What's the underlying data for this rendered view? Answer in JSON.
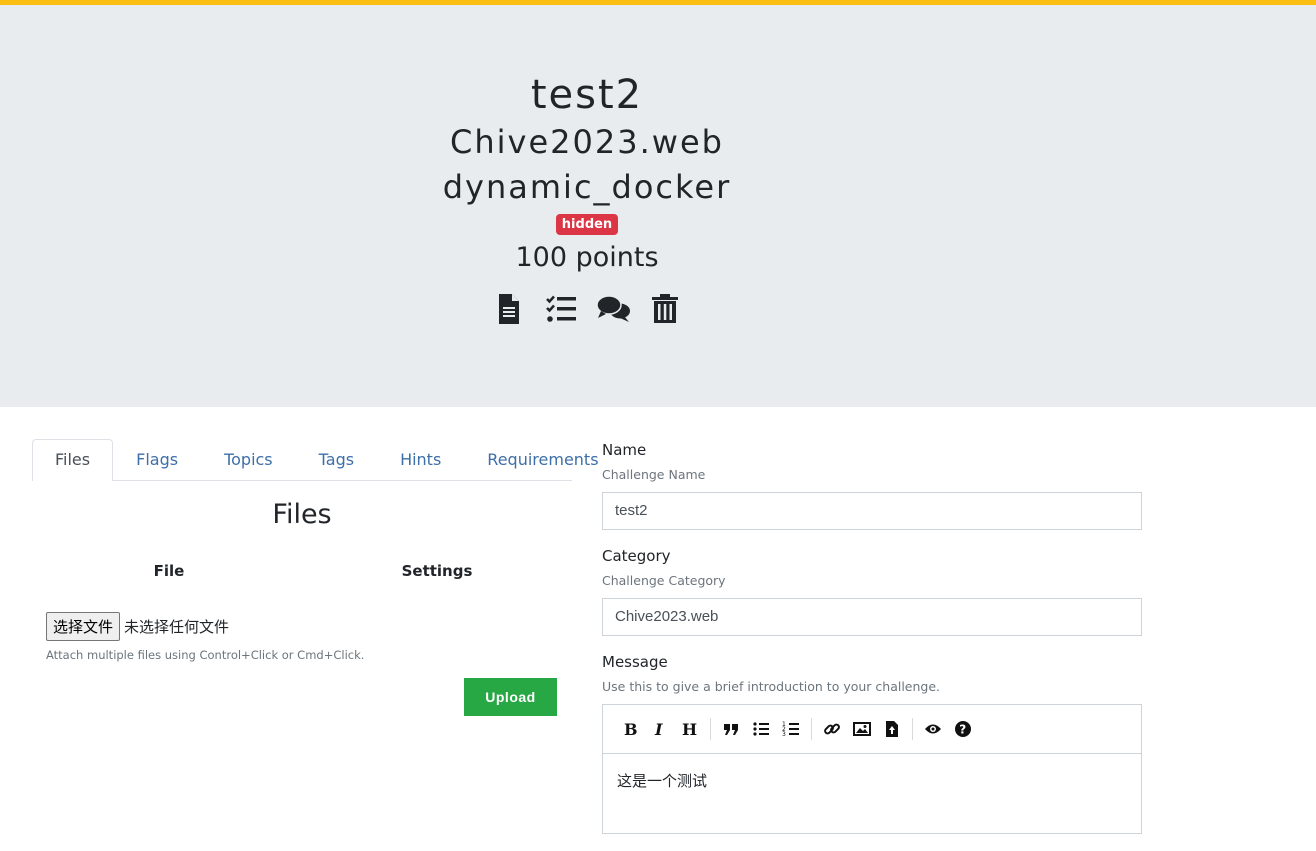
{
  "challenge": {
    "name": "test2",
    "category": "Chive2023.web",
    "type": "dynamic_docker",
    "state_badge": "hidden",
    "points": "100 points"
  },
  "header_icons": [
    "file-text-icon",
    "tasks-icon",
    "comments-icon",
    "trash-icon"
  ],
  "tabs": [
    "Files",
    "Flags",
    "Topics",
    "Tags",
    "Hints",
    "Requirements"
  ],
  "files_panel": {
    "title": "Files",
    "col_file": "File",
    "col_settings": "Settings",
    "choose_button": "选择文件",
    "no_file_text": "未选择任何文件",
    "hint": "Attach multiple files using Control+Click or Cmd+Click.",
    "upload_label": "Upload"
  },
  "form": {
    "name_label": "Name",
    "name_help": "Challenge Name",
    "name_value": "test2",
    "category_label": "Category",
    "category_help": "Challenge Category",
    "category_value": "Chive2023.web",
    "message_label": "Message",
    "message_help": "Use this to give a brief introduction to your challenge.",
    "message_value": "这是一个测试"
  },
  "colors": {
    "topbar": "#fbbf14",
    "jumbotron": "#e9ecef",
    "badge": "#dc3545",
    "upload": "#28a745",
    "link": "#3d6fa8"
  }
}
